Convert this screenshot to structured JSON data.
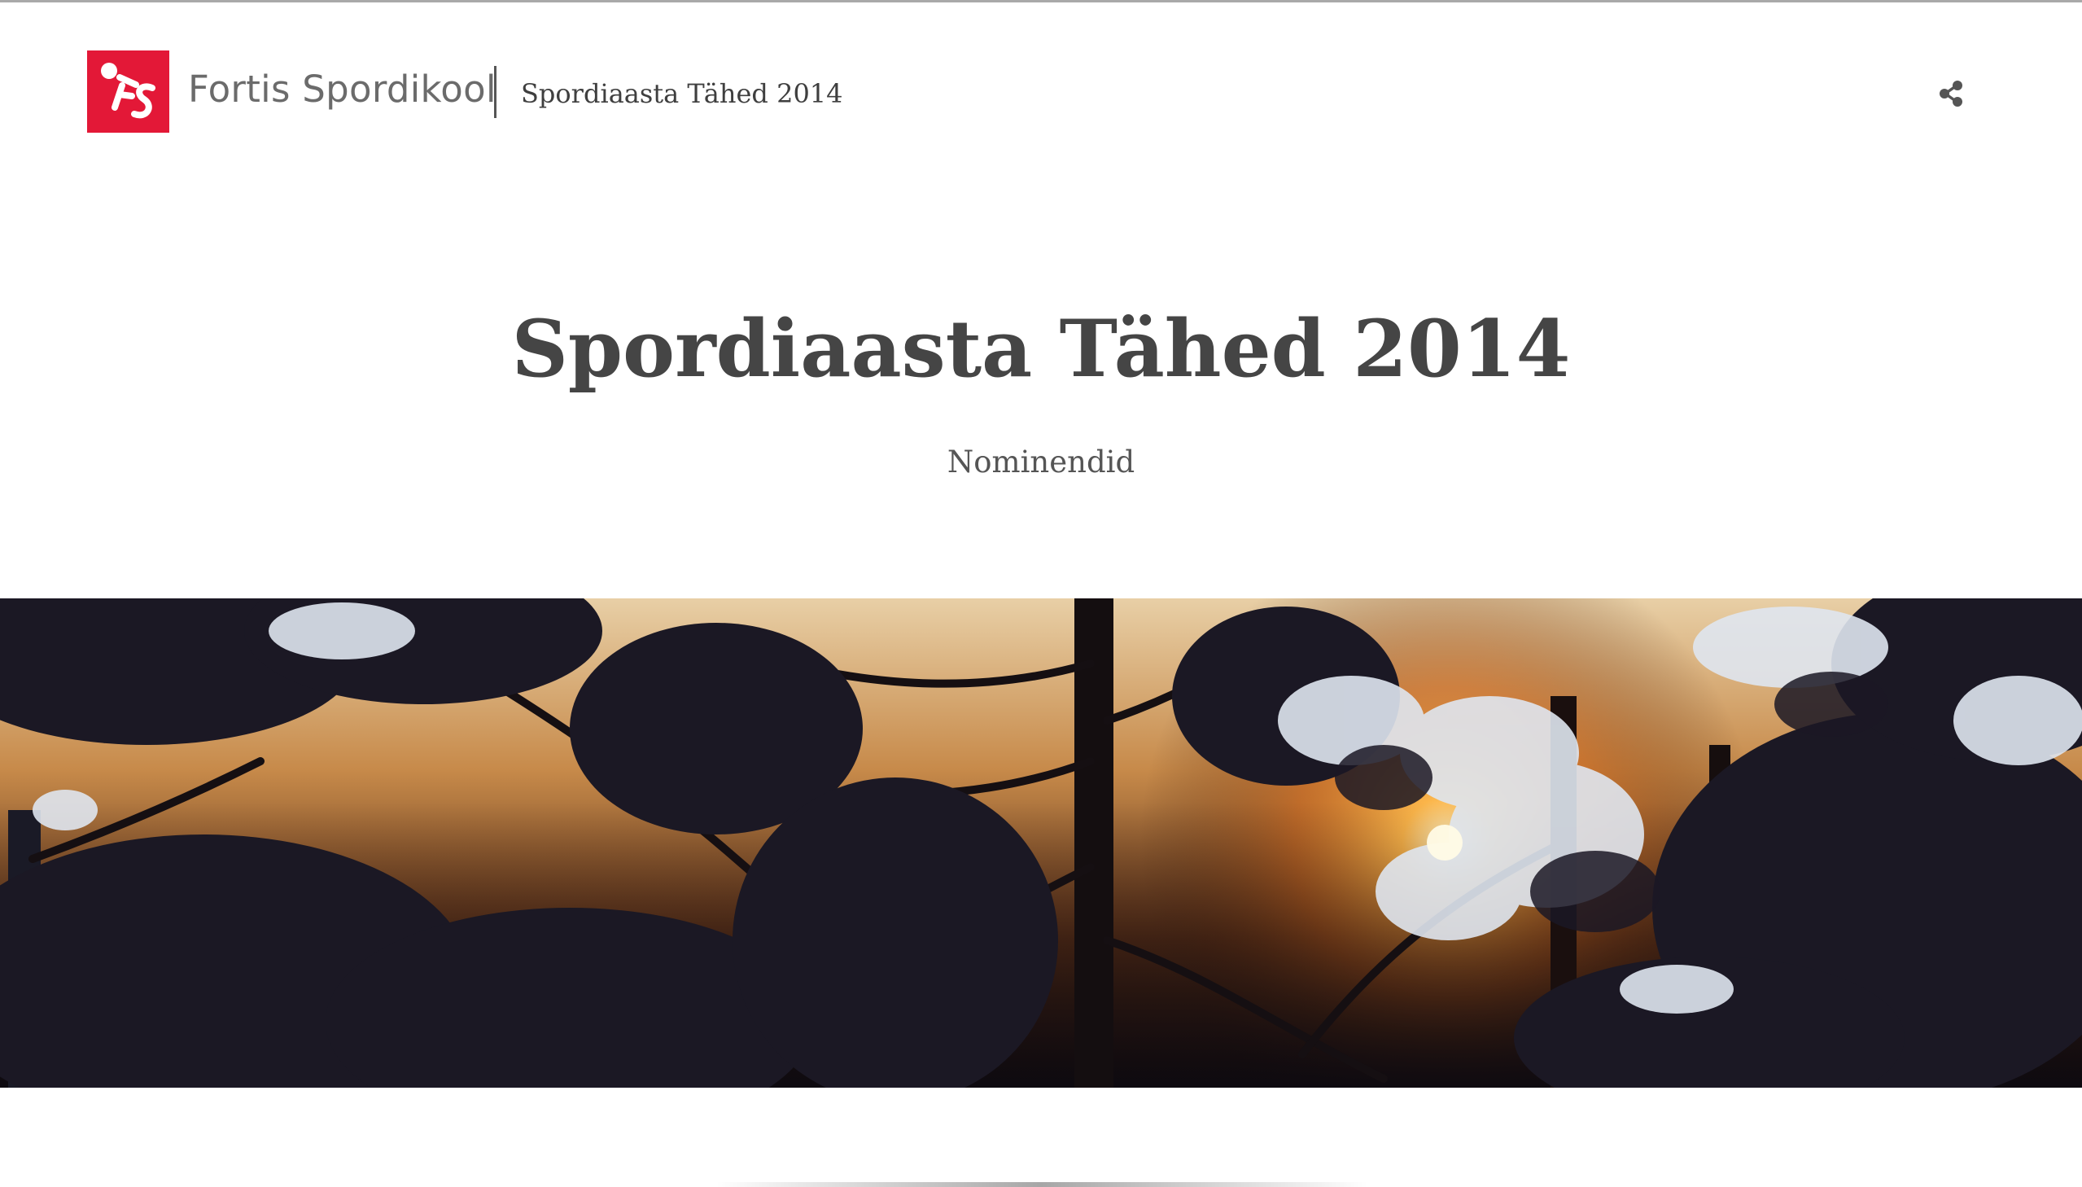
{
  "header": {
    "brand_name": "Fortis Spordikool",
    "logo_text": "FS",
    "story_title": "Spordiaasta Tähed 2014",
    "share_icon": "share-icon"
  },
  "hero": {
    "title": "Spordiaasta Tähed 2014",
    "subtitle": "Nominendid"
  },
  "colors": {
    "brand_red": "#e31837",
    "text_dark": "#454545",
    "text_muted": "#6b6b6b"
  },
  "photo": {
    "subject": "snowy-pine-branches-sunset"
  }
}
